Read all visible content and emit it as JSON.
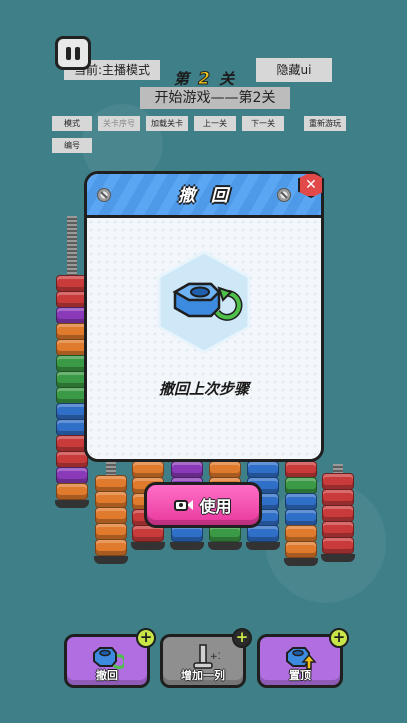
{
  "top": {
    "mode_label": "当前:主播模式",
    "hide_ui": "隐藏ui",
    "level_prefix": "第",
    "level_number": "2",
    "level_suffix": "关",
    "start_game": "开始游戏——第2关"
  },
  "debug_buttons": [
    {
      "label": "模式"
    },
    {
      "label": "关卡序号"
    },
    {
      "label": "加载关卡"
    },
    {
      "label": "上一关"
    },
    {
      "label": "下一关"
    },
    {
      "label": "重新游玩"
    },
    {
      "label": "编号"
    }
  ],
  "dialog": {
    "title": "撤回",
    "description": "撤回上次步骤",
    "use_button": "使用",
    "close_symbol": "✕"
  },
  "tools": [
    {
      "label": "撤回",
      "color": "#b06ee0",
      "badge": "+",
      "state": "active"
    },
    {
      "label": "增加一列",
      "color": "#8f8f8f",
      "badge": "+",
      "state": "disabled"
    },
    {
      "label": "置顶",
      "color": "#b06ee0",
      "badge": "+",
      "state": "active"
    }
  ],
  "colors": {
    "accent_blue": "#5aa6f2",
    "use_button_pink": "#e8389d",
    "tool_purple": "#b06ee0",
    "badge_green": "#c8e648"
  }
}
